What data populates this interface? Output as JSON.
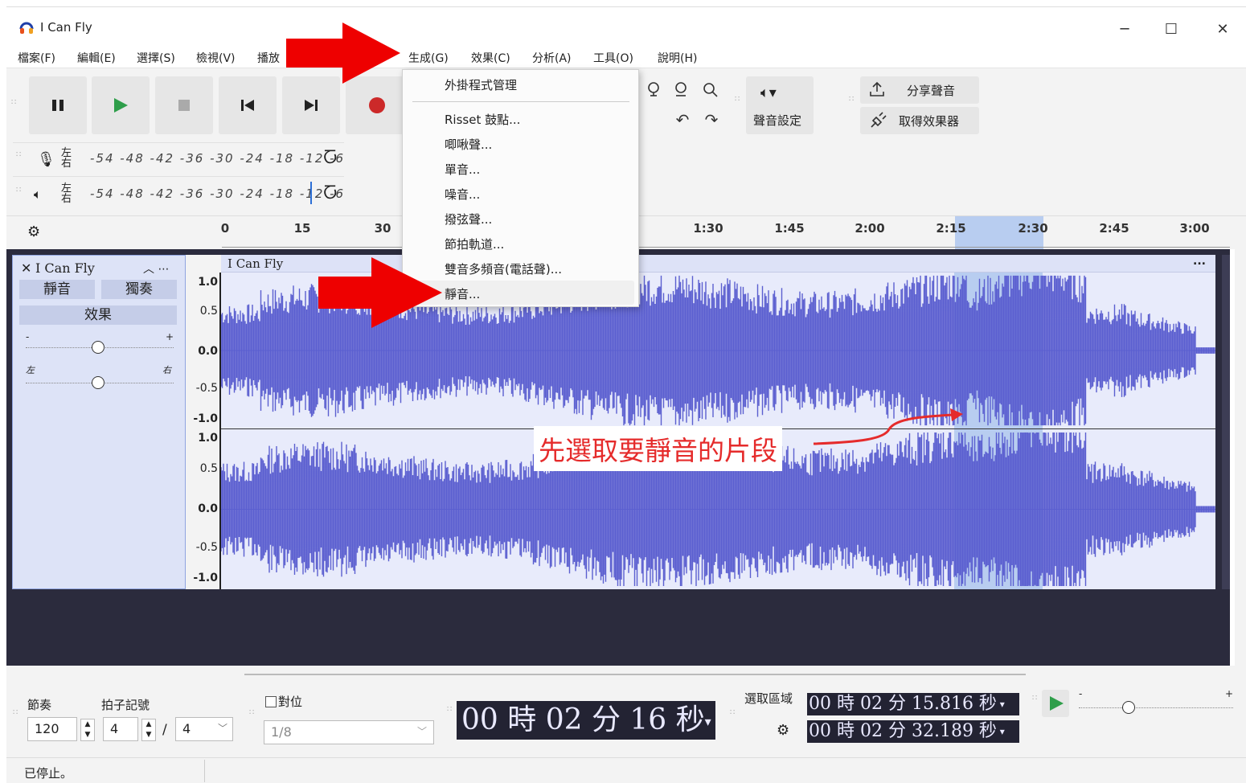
{
  "window": {
    "title": "I Can Fly"
  },
  "menu": [
    "檔案(F)",
    "編輯(E)",
    "選擇(S)",
    "檢視(V)",
    "播放",
    "生成(G)",
    "效果(C)",
    "分析(A)",
    "工具(O)",
    "說明(H)"
  ],
  "toolbar": {
    "audio_setup_label": "聲音設定",
    "share_audio_label": "分享聲音",
    "get_effects_label": "取得效果器"
  },
  "meters": {
    "left_right": "左右",
    "scale": "-54 -48 -42 -36 -30 -24 -18 -12 -6"
  },
  "timeline": {
    "ticks": [
      "0",
      "15",
      "30",
      "1:30",
      "1:45",
      "2:00",
      "2:15",
      "2:30",
      "2:45",
      "3:00"
    ]
  },
  "track": {
    "name": "I Can Fly",
    "clip_name": "I Can Fly",
    "clip_menu": "...",
    "mute_label": "靜音",
    "solo_label": "獨奏",
    "effects_label": "效果",
    "pan_left": "左",
    "pan_right": "右",
    "gain_minus": "-",
    "gain_plus": "+",
    "y_labels": [
      "1.0",
      "0.5",
      "0.0",
      "-0.5",
      "-1.0"
    ]
  },
  "generate_menu": {
    "items": [
      "外掛程式管理",
      "Risset 鼓點...",
      "唧啾聲...",
      "單音...",
      "噪音...",
      "撥弦聲...",
      "節拍軌道...",
      "雙音多頻音(電話聲)...",
      "靜音..."
    ],
    "highlighted_index": 8
  },
  "annotation": {
    "text": "先選取要靜音的片段",
    "color": "#e52b2b"
  },
  "bottom": {
    "tempo_label": "節奏",
    "tempo_value": "120",
    "timesig_label": "拍子記號",
    "timesig_num": "4",
    "timesig_sep": "/",
    "timesig_den": "4",
    "snap_label": "對位",
    "snap_value": "1/8",
    "time_display": "00 時 02 分 16 秒",
    "selection_label": "選取區域",
    "sel_start": "00 時 02 分 15.816 秒",
    "sel_end": "00 時 02 分 32.189 秒",
    "playback_minus": "-",
    "playback_plus": "+"
  },
  "status": {
    "text": "已停止。"
  },
  "colors": {
    "waveform": "#5b5fd0",
    "selection": "#b8cdf0",
    "arrow": "#ee0000",
    "record": "#cc2929",
    "play": "#2e9e4a"
  }
}
